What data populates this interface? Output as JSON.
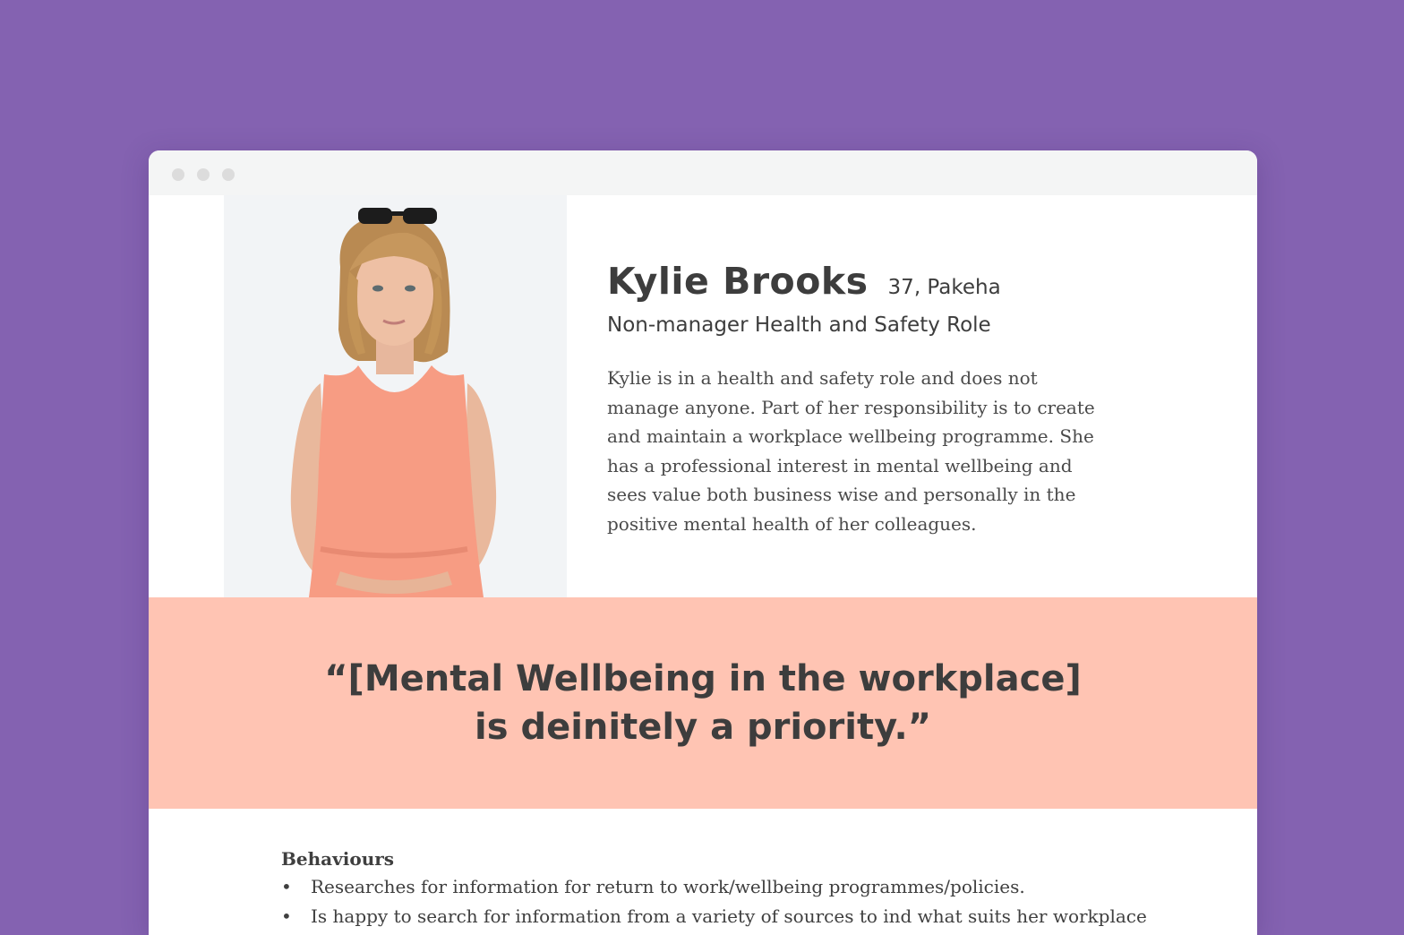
{
  "window": {
    "controls": [
      "dot",
      "dot",
      "dot"
    ]
  },
  "persona": {
    "name": "Kylie Brooks",
    "meta": "37, Pakeha",
    "role": "Non-manager Health and Safety Role",
    "bio_lines": [
      "Kylie is in a health and safety role and does not",
      "manage anyone. Part of her responsibility is to create",
      "and maintain a workplace wellbeing programme. She",
      "has a professional interest in mental wellbeing and",
      "sees value both business wise and personally in the",
      "positive mental health of her colleagues."
    ]
  },
  "quote": {
    "line1": "“[Mental Wellbeing in the workplace]",
    "line2": "is deinitely a priority.”"
  },
  "behaviours": {
    "title": "Behaviours",
    "items": [
      "Researches for information for return to work/wellbeing programmes/policies.",
      "Is happy to search for information from a variety of sources to ind what suits her workplace"
    ]
  },
  "colors": {
    "background": "#8462b1",
    "quote_band": "#ffc4b3",
    "text": "#3d3d3d"
  }
}
